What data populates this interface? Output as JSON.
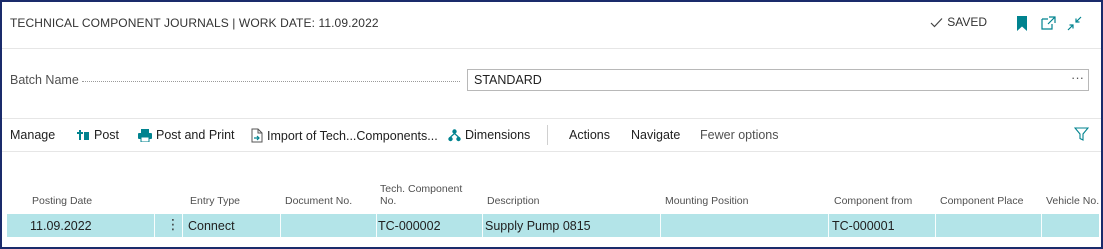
{
  "header": {
    "title": "TECHNICAL COMPONENT JOURNALS | WORK DATE: 11.09.2022",
    "saved_label": "SAVED"
  },
  "batch": {
    "label": "Batch Name",
    "value": "STANDARD",
    "more": "···"
  },
  "actions": {
    "manage": "Manage",
    "post": "Post",
    "post_and_print": "Post and Print",
    "import": "Import of Tech...Components...",
    "dimensions": "Dimensions",
    "actions": "Actions",
    "navigate": "Navigate",
    "fewer_options": "Fewer options"
  },
  "table": {
    "columns": {
      "posting_date": "Posting Date",
      "entry_type": "Entry Type",
      "document_no": "Document No.",
      "tech_component_no_1": "Tech. Component",
      "tech_component_no_2": "No.",
      "description": "Description",
      "mounting_position": "Mounting Position",
      "component_from": "Component from",
      "component_place": "Component Place",
      "vehicle_no": "Vehicle No."
    },
    "rows": [
      {
        "posting_date": "11.09.2022",
        "entry_type": "Connect",
        "document_no": "",
        "tech_component_no": "TC-000002",
        "description": "Supply Pump 0815",
        "mounting_position": "",
        "component_from": "TC-000001",
        "component_place": "",
        "vehicle_no": ""
      }
    ]
  },
  "colors": {
    "accent": "#00838f",
    "selected_row": "#b3e4e8",
    "frame_border": "#1a2b6b"
  },
  "icons": {
    "saved": "checkmark-icon",
    "bookmark": "bookmark-icon",
    "open_new": "open-new-window-icon",
    "collapse": "collapse-icon",
    "post": "post-icon",
    "post_and_print": "print-icon",
    "import": "document-import-icon",
    "dimensions": "dimensions-icon",
    "filter": "filter-icon",
    "row_menu": "vertical-ellipsis-icon"
  }
}
